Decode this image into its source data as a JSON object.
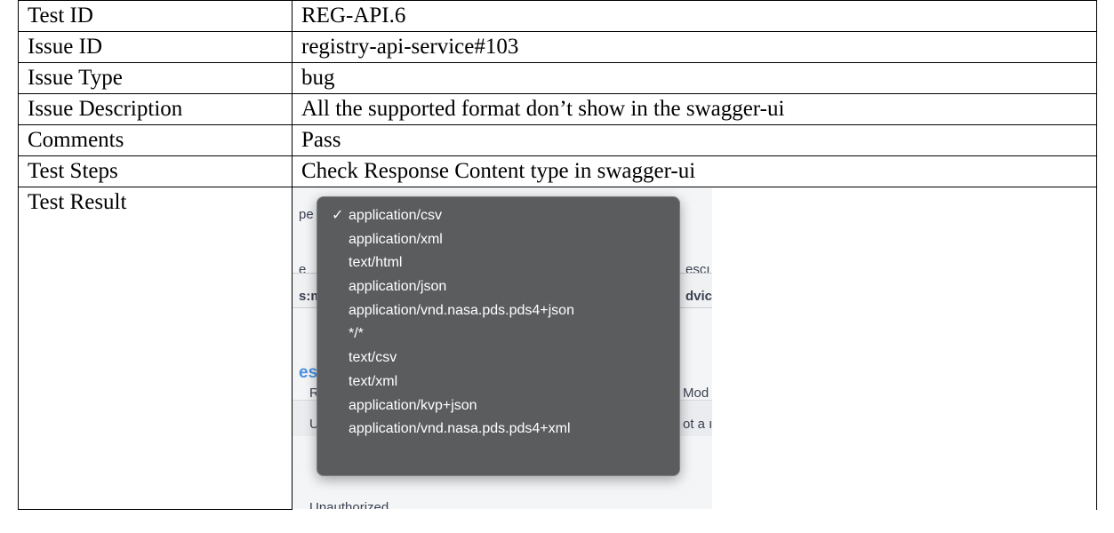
{
  "rows": [
    {
      "label": "Test ID",
      "value": "REG-API.6"
    },
    {
      "label": "Issue ID",
      "value": "registry-api-service#103"
    },
    {
      "label": "Issue Type",
      "value": "bug"
    },
    {
      "label": "Issue Description",
      "value": "All the supported format don’t show in the swagger-ui"
    },
    {
      "label": "Comments",
      "value": "Pass"
    },
    {
      "label": "Test Steps",
      "value": "Check Response Content type in swagger-ui"
    },
    {
      "label": "Test Result"
    }
  ],
  "screenshot": {
    "fragments": {
      "type_cut": "pe",
      "name_cut": "e",
      "desc_cut": "escı",
      "field_cut": "s:m",
      "advice_cut": "dvic",
      "responses_cut": "es",
      "code_col_cut": "R",
      "model_col_cut": "Mod",
      "row_cut": "U",
      "row_right_cut": "ot a ı",
      "unauthorized": "Unauthorized"
    },
    "menu": {
      "selected_index": 0,
      "check_glyph": "✓",
      "items": [
        "application/csv",
        "application/xml",
        "text/html",
        "application/json",
        "application/vnd.nasa.pds.pds4+json",
        "*/*",
        "text/csv",
        "text/xml",
        "application/kvp+json",
        "application/vnd.nasa.pds.pds4+xml"
      ]
    }
  }
}
